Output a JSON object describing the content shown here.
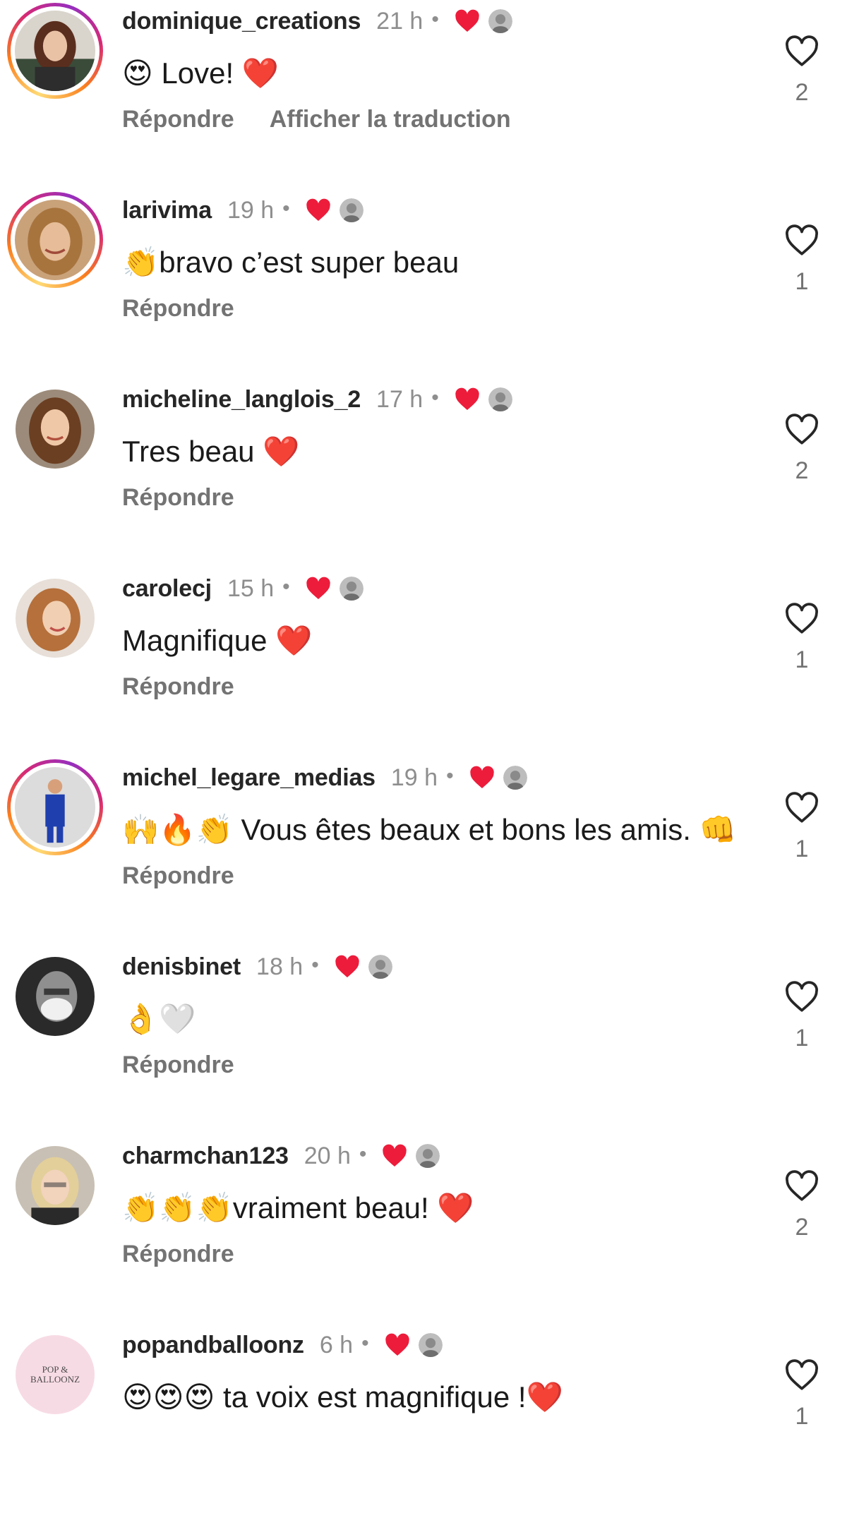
{
  "colors": {
    "username": "#262626",
    "meta_gray": "#8e8e8e",
    "action_gray": "#737373",
    "creator_heart": "#ed1c3b",
    "like_outline": "#262626"
  },
  "actions": {
    "reply": "Répondre",
    "translate": "Afficher la traduction"
  },
  "separator": "•",
  "icons": {
    "creator_like": "red-heart-icon",
    "creator_avatar": "creator-avatar",
    "like": "heart-outline-icon"
  },
  "comments": [
    {
      "username": "dominique_creations",
      "time": "21 h",
      "text": "😍 Love! ❤️",
      "likes": "2",
      "story_ring": true,
      "show_translate": true
    },
    {
      "username": "larivima",
      "time": "19 h",
      "text": "👏bravo c’est super beau",
      "likes": "1",
      "story_ring": true,
      "show_translate": false
    },
    {
      "username": "micheline_langlois_2",
      "time": "17 h",
      "text": "Tres beau ❤️",
      "likes": "2",
      "story_ring": false,
      "show_translate": false
    },
    {
      "username": "carolecj",
      "time": "15 h",
      "text": "Magnifique ❤️",
      "likes": "1",
      "story_ring": false,
      "show_translate": false
    },
    {
      "username": "michel_legare_medias",
      "time": "19 h",
      "text": "🙌🔥👏 Vous êtes beaux et bons les amis. 👊",
      "likes": "1",
      "story_ring": true,
      "show_translate": false
    },
    {
      "username": "denisbinet",
      "time": "18 h",
      "text": "👌🤍",
      "likes": "1",
      "story_ring": false,
      "show_translate": false
    },
    {
      "username": "charmchan123",
      "time": "20 h",
      "text": "👏👏👏vraiment beau! ❤️",
      "likes": "2",
      "story_ring": false,
      "show_translate": false
    },
    {
      "username": "popandballoonz",
      "time": "6 h",
      "text": "😍😍😍 ta voix est magnifique !❤️",
      "likes": "1",
      "story_ring": false,
      "show_translate": false,
      "avatar_text": "POP & BALLOONZ"
    }
  ]
}
